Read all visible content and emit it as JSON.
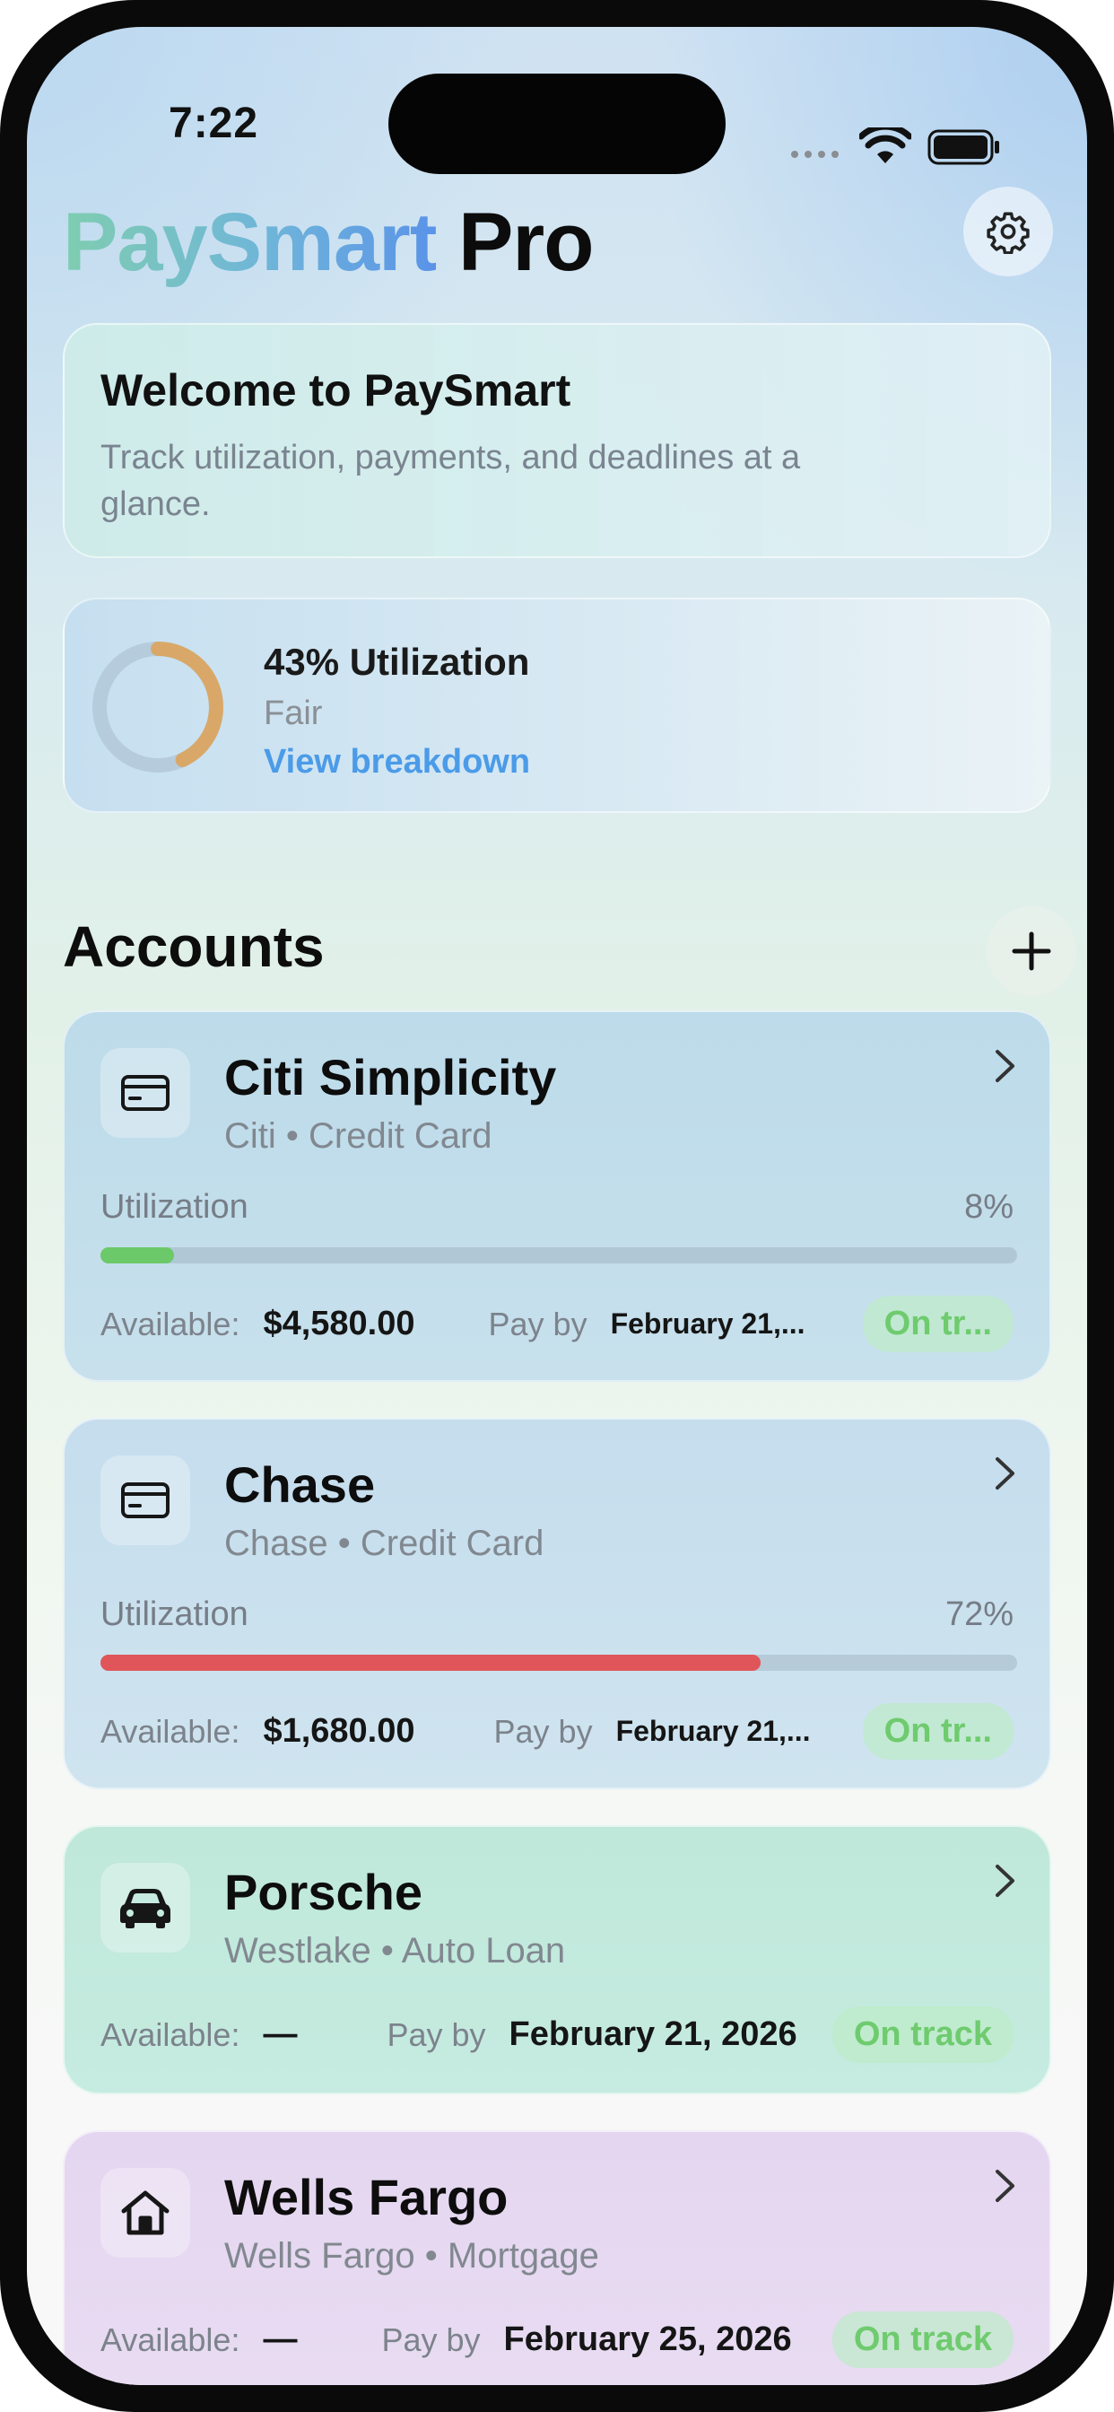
{
  "status_bar": {
    "time": "7:22"
  },
  "app": {
    "title_highlight": "PaySmart",
    "title_rest": "Pro"
  },
  "welcome": {
    "title": "Welcome to PaySmart",
    "subtitle": "Track utilization, payments, and deadlines at a glance."
  },
  "utilization_summary": {
    "percent": 43,
    "percent_text": "43% Utilization",
    "rating": "Fair",
    "link": "View breakdown",
    "ring_color": "#d9a869"
  },
  "accounts_section": {
    "title": "Accounts"
  },
  "accounts": [
    {
      "name": "Citi Simplicity",
      "subtitle": "Citi • Credit Card",
      "icon": "credit-card-icon",
      "utilization_label": "Utilization",
      "utilization_text": "8%",
      "utilization": 8,
      "bar_color": "#6cc96a",
      "available_label": "Available:",
      "available_value": "$4,580.00",
      "pay_by_label": "Pay by",
      "pay_by_value": "February 21,...",
      "status": "On tr..."
    },
    {
      "name": "Chase",
      "subtitle": "Chase • Credit Card",
      "icon": "credit-card-icon",
      "utilization_label": "Utilization",
      "utilization_text": "72%",
      "utilization": 72,
      "bar_color": "#e0555a",
      "available_label": "Available:",
      "available_value": "$1,680.00",
      "pay_by_label": "Pay by",
      "pay_by_value": "February 21,...",
      "status": "On tr..."
    },
    {
      "name": "Porsche",
      "subtitle": "Westlake • Auto Loan",
      "icon": "car-icon",
      "available_label": "Available:",
      "available_value": "—",
      "pay_by_label": "Pay by",
      "pay_by_value": "February 21, 2026",
      "status": "On track"
    },
    {
      "name": "Wells Fargo",
      "subtitle": "Wells Fargo • Mortgage",
      "icon": "house-icon",
      "available_label": "Available:",
      "available_value": "—",
      "pay_by_label": "Pay by",
      "pay_by_value": "February 25, 2026",
      "status": "On track"
    }
  ]
}
